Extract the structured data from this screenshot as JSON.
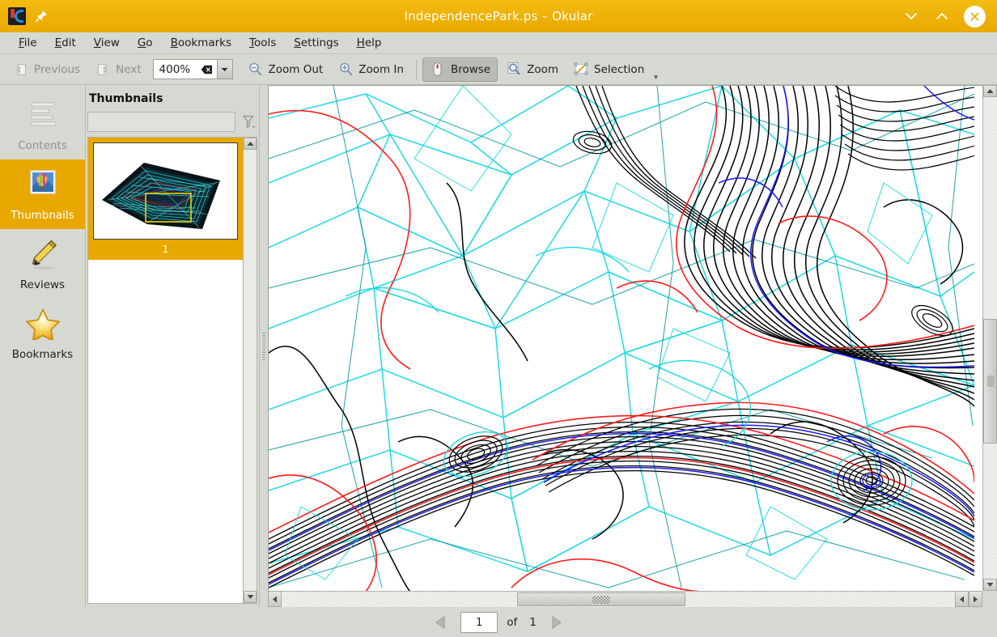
{
  "window": {
    "title": "IndependencePark.ps – Okular",
    "app_icon": "okular-logo-icon",
    "pin_icon": "pin-icon",
    "minimize_icon": "chevron-down-icon",
    "maximize_icon": "chevron-up-icon",
    "close_icon": "close-icon",
    "titlebar_color": "#eeb208",
    "accent_color": "#e8a800"
  },
  "menubar": {
    "items": [
      {
        "label": "File",
        "mnemonic": "F"
      },
      {
        "label": "Edit",
        "mnemonic": "E"
      },
      {
        "label": "View",
        "mnemonic": "V"
      },
      {
        "label": "Go",
        "mnemonic": "G"
      },
      {
        "label": "Bookmarks",
        "mnemonic": "B"
      },
      {
        "label": "Tools",
        "mnemonic": "T"
      },
      {
        "label": "Settings",
        "mnemonic": "S"
      },
      {
        "label": "Help",
        "mnemonic": "H"
      }
    ]
  },
  "toolbar": {
    "previous_label": "Previous",
    "previous_icon": "previous-page-icon",
    "previous_enabled": false,
    "next_label": "Next",
    "next_icon": "next-page-icon",
    "next_enabled": false,
    "zoom_value": "400%",
    "zoom_clear_icon": "clear-icon",
    "zoom_dropdown_icon": "chevron-down-icon",
    "zoom_out_label": "Zoom Out",
    "zoom_out_icon": "zoom-out-icon",
    "zoom_in_label": "Zoom In",
    "zoom_in_icon": "zoom-in-icon",
    "browse_label": "Browse",
    "browse_icon": "mouse-icon",
    "browse_active": true,
    "zoom_label": "Zoom",
    "zoom_icon": "magnifier-icon",
    "selection_label": "Selection",
    "selection_icon": "selection-icon",
    "overflow_icon": "toolbar-overflow-icon"
  },
  "sidebar": {
    "items": [
      {
        "label": "Contents",
        "icon": "contents-icon",
        "selected": false,
        "enabled": false
      },
      {
        "label": "Thumbnails",
        "icon": "thumbnails-icon",
        "selected": true,
        "enabled": true
      },
      {
        "label": "Reviews",
        "icon": "pencil-icon",
        "selected": false,
        "enabled": true
      },
      {
        "label": "Bookmarks",
        "icon": "star-icon",
        "selected": false,
        "enabled": true
      }
    ]
  },
  "thumbnails_panel": {
    "header": "Thumbnails",
    "filter_placeholder": "",
    "filter_value": "",
    "filter_icon": "funnel-icon",
    "scroll_up_icon": "scroll-up-icon",
    "scroll_down_icon": "scroll-down-icon",
    "pages": [
      {
        "number": "1",
        "selected": true
      }
    ]
  },
  "viewer": {
    "document_type": "topographic-contour-map",
    "vertical_scrollbar": {
      "up_icon": "scroll-up-icon",
      "down_icon": "scroll-down-icon",
      "thumb_position_pct": 46,
      "thumb_size_pct": 26
    },
    "horizontal_scrollbar": {
      "left_icon": "scroll-left-icon",
      "right_icon": "scroll-right-icon",
      "thumb_position_pct": 35,
      "thumb_size_pct": 25
    }
  },
  "statusbar": {
    "prev_page_icon": "triangle-left-icon",
    "page_number": "1",
    "of_label": "of",
    "total_pages": "1",
    "next_page_icon": "triangle-right-icon"
  }
}
